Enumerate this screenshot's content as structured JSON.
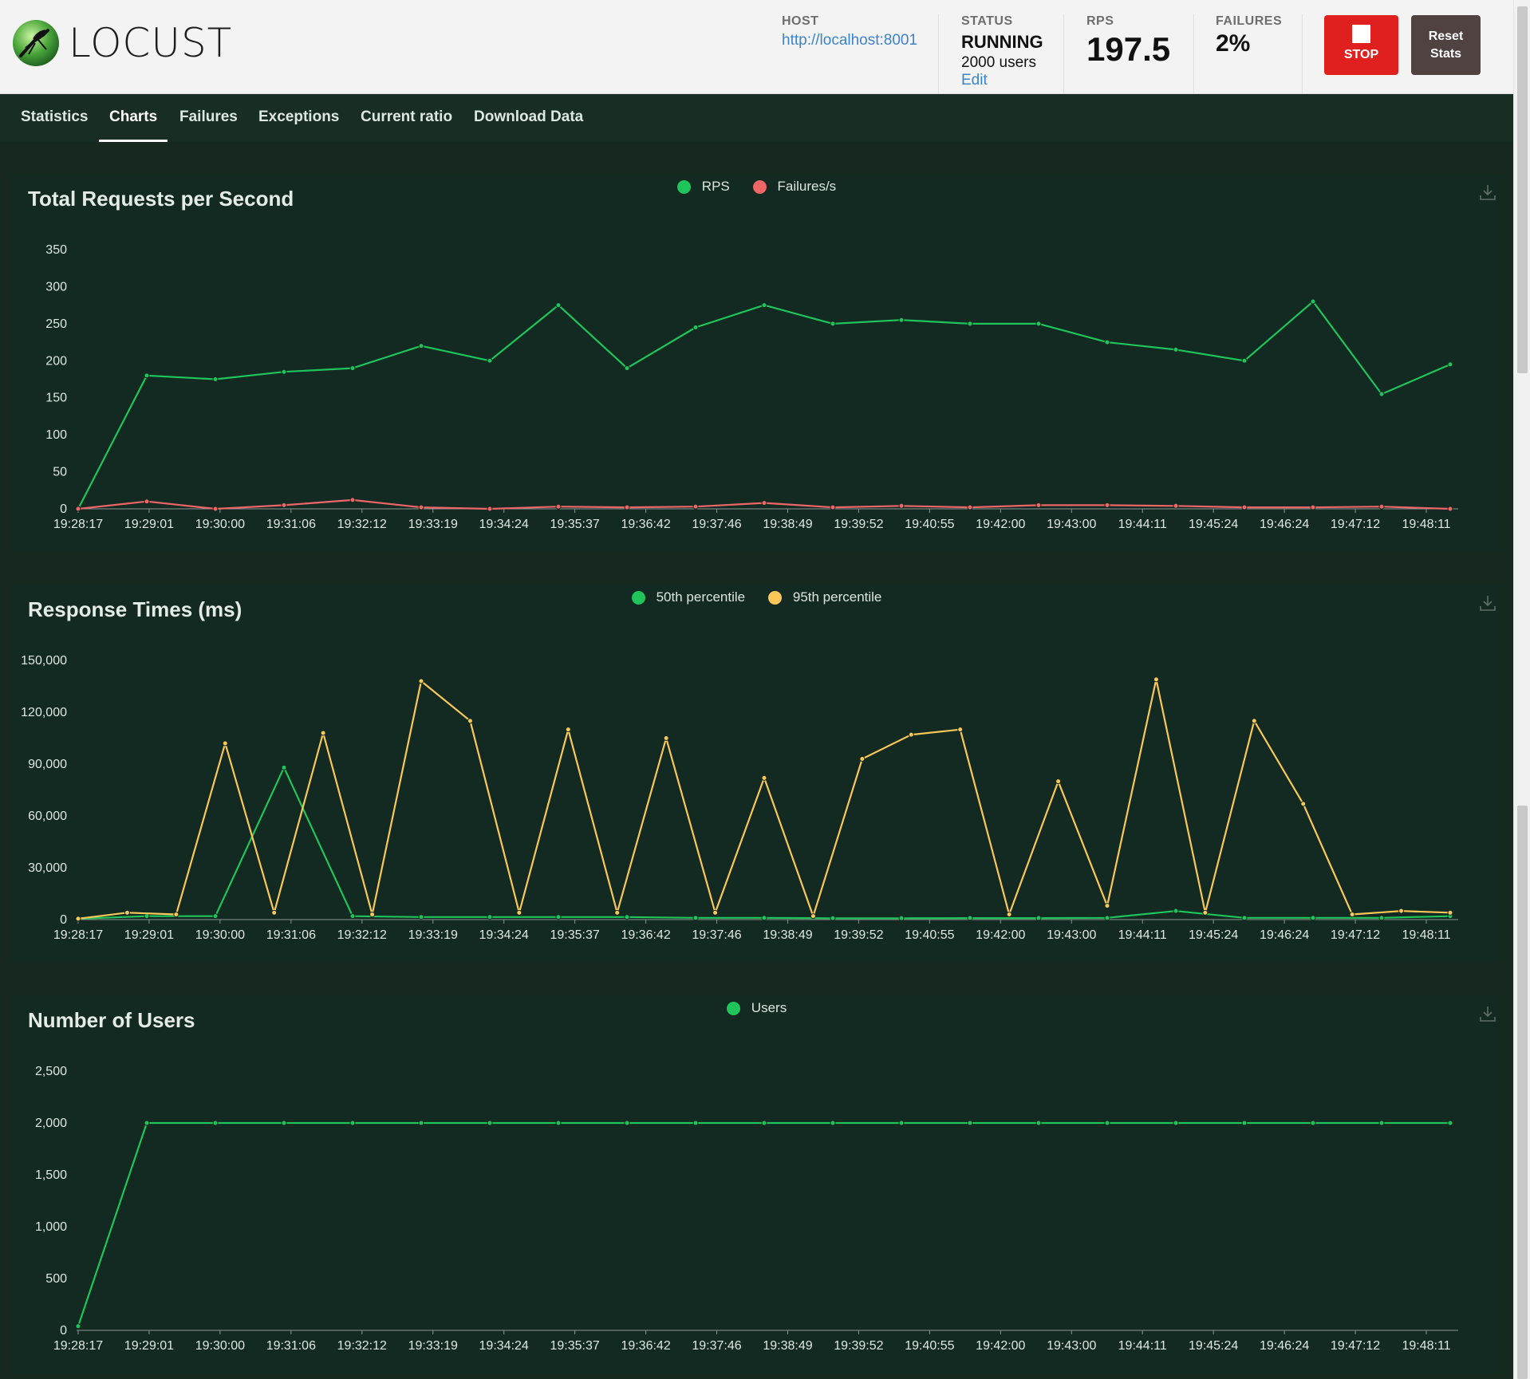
{
  "header": {
    "logo_text": "LOCUST",
    "host_label": "HOST",
    "host_value": "http://localhost:8001",
    "status_label": "STATUS",
    "status_value": "RUNNING",
    "status_users": "2000 users",
    "status_edit": "Edit",
    "rps_label": "RPS",
    "rps_value": "197.5",
    "failures_label": "FAILURES",
    "failures_value": "2%",
    "stop_label": "STOP",
    "reset_label_1": "Reset",
    "reset_label_2": "Stats"
  },
  "nav": {
    "tabs": [
      {
        "label": "Statistics",
        "active": false
      },
      {
        "label": "Charts",
        "active": true
      },
      {
        "label": "Failures",
        "active": false
      },
      {
        "label": "Exceptions",
        "active": false
      },
      {
        "label": "Current ratio",
        "active": false
      },
      {
        "label": "Download Data",
        "active": false
      }
    ]
  },
  "colors": {
    "green": "#1fc45a",
    "red": "#ee6666",
    "yellow": "#fac858"
  },
  "chart_data": [
    {
      "type": "line",
      "title": "Total Requests per Second",
      "x": [
        "19:28:17",
        "19:29:01",
        "19:30:00",
        "19:31:06",
        "19:32:12",
        "19:33:19",
        "19:34:24",
        "19:35:37",
        "19:36:42",
        "19:37:46",
        "19:38:49",
        "19:39:52",
        "19:40:55",
        "19:42:00",
        "19:43:00",
        "19:44:11",
        "19:45:24",
        "19:46:24",
        "19:47:12",
        "19:48:11"
      ],
      "yticks": [
        0,
        50,
        100,
        150,
        200,
        250,
        300,
        350
      ],
      "yticks_text": [
        "0",
        "50",
        "100",
        "150",
        "200",
        "250",
        "300",
        "350"
      ],
      "ylim": [
        0,
        350
      ],
      "series": [
        {
          "name": "RPS",
          "color": "#1fc45a",
          "values": [
            0,
            180,
            175,
            185,
            190,
            220,
            200,
            275,
            190,
            245,
            275,
            250,
            255,
            250,
            250,
            225,
            215,
            200,
            280,
            155,
            195
          ]
        },
        {
          "name": "Failures/s",
          "color": "#ee6666",
          "values": [
            0,
            10,
            0,
            5,
            12,
            2,
            0,
            3,
            2,
            3,
            8,
            2,
            4,
            2,
            5,
            5,
            4,
            2,
            2,
            3,
            0
          ]
        }
      ]
    },
    {
      "type": "line",
      "title": "Response Times (ms)",
      "x": [
        "19:28:17",
        "19:29:01",
        "19:30:00",
        "19:31:06",
        "19:32:12",
        "19:33:19",
        "19:34:24",
        "19:35:37",
        "19:36:42",
        "19:37:46",
        "19:38:49",
        "19:39:52",
        "19:40:55",
        "19:42:00",
        "19:43:00",
        "19:44:11",
        "19:45:24",
        "19:46:24",
        "19:47:12",
        "19:48:11"
      ],
      "yticks": [
        0,
        30000,
        60000,
        90000,
        120000,
        150000
      ],
      "yticks_text": [
        "0",
        "30,000",
        "60,000",
        "90,000",
        "120,000",
        "150,000"
      ],
      "ylim": [
        0,
        150000
      ],
      "series": [
        {
          "name": "50th percentile",
          "color": "#1fc45a",
          "values": [
            500,
            2000,
            2000,
            88000,
            2000,
            1500,
            1500,
            1500,
            1500,
            1000,
            1000,
            800,
            800,
            900,
            900,
            1000,
            5000,
            1000,
            1000,
            1000,
            2000
          ]
        },
        {
          "name": "95th percentile",
          "color": "#fac858",
          "values": [
            500,
            4000,
            3000,
            102000,
            4000,
            108000,
            3000,
            138000,
            115000,
            4000,
            110000,
            4000,
            105000,
            4000,
            82000,
            2000,
            93000,
            107000,
            110000,
            3000,
            80000,
            8000,
            139000,
            4000,
            115000,
            67000,
            3000,
            5000,
            4000
          ]
        }
      ]
    },
    {
      "type": "line",
      "title": "Number of Users",
      "x": [
        "19:28:17",
        "19:29:01",
        "19:30:00",
        "19:31:06",
        "19:32:12",
        "19:33:19",
        "19:34:24",
        "19:35:37",
        "19:36:42",
        "19:37:46",
        "19:38:49",
        "19:39:52",
        "19:40:55",
        "19:42:00",
        "19:43:00",
        "19:44:11",
        "19:45:24",
        "19:46:24",
        "19:47:12",
        "19:48:11"
      ],
      "yticks": [
        0,
        500,
        1000,
        1500,
        2000,
        2500
      ],
      "yticks_text": [
        "0",
        "500",
        "1,000",
        "1,500",
        "2,000",
        "2,500"
      ],
      "ylim": [
        0,
        2500
      ],
      "series": [
        {
          "name": "Users",
          "color": "#1fc45a",
          "values": [
            40,
            2000,
            2000,
            2000,
            2000,
            2000,
            2000,
            2000,
            2000,
            2000,
            2000,
            2000,
            2000,
            2000,
            2000,
            2000,
            2000,
            2000,
            2000,
            2000,
            2000
          ]
        }
      ]
    }
  ]
}
